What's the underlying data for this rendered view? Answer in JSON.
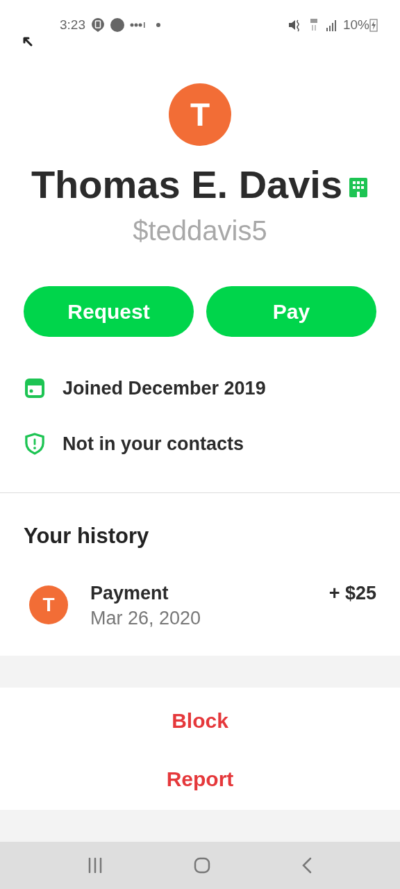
{
  "status_bar": {
    "time": "3:23",
    "battery": "10%"
  },
  "profile": {
    "avatar_letter": "T",
    "name": "Thomas E. Davis",
    "handle": "$teddavis5"
  },
  "actions": [
    "Request",
    "Pay"
  ],
  "info": [
    {
      "kind": "calendar",
      "text": "Joined December 2019"
    },
    {
      "kind": "shield",
      "text": "Not in your contacts"
    }
  ],
  "history": {
    "title": "Your history",
    "items": [
      {
        "avatar_letter": "T",
        "title": "Payment",
        "date": "Mar 26, 2020",
        "amount": "+ $25"
      }
    ]
  },
  "danger_actions": [
    "Block",
    "Report"
  ]
}
